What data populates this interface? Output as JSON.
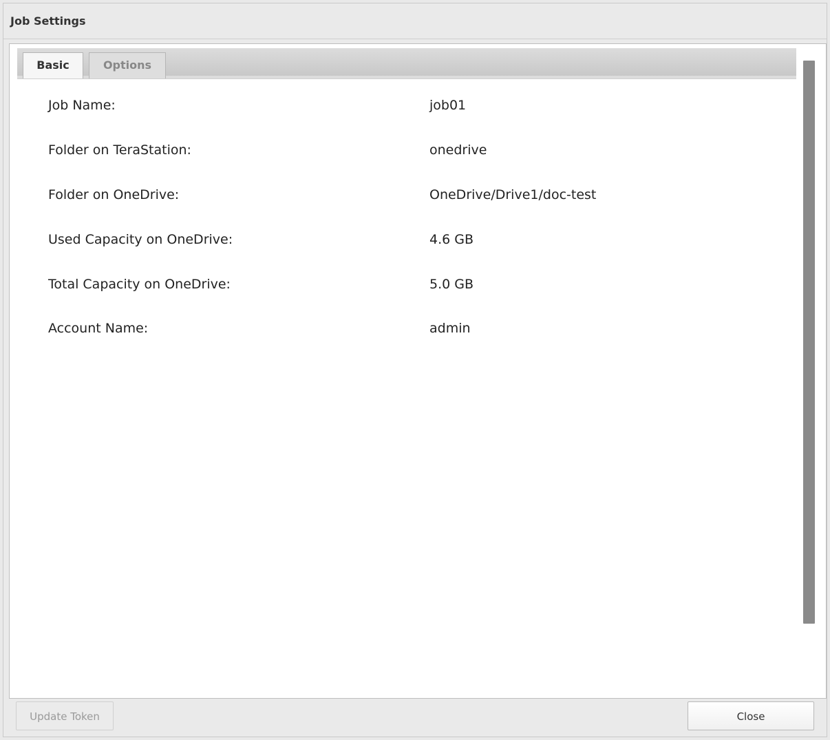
{
  "window": {
    "title": "Job Settings"
  },
  "tabs": [
    {
      "label": "Basic",
      "active": true
    },
    {
      "label": "Options",
      "active": false
    }
  ],
  "details": [
    {
      "label": "Job Name:",
      "value": "job01"
    },
    {
      "label": "Folder on TeraStation:",
      "value": "onedrive"
    },
    {
      "label": "Folder on OneDrive:",
      "value": "OneDrive/Drive1/doc-test"
    },
    {
      "label": "Used Capacity on OneDrive:",
      "value": "4.6 GB"
    },
    {
      "label": "Total Capacity on OneDrive:",
      "value": "5.0 GB"
    },
    {
      "label": "Account Name:",
      "value": "admin"
    }
  ],
  "buttons": {
    "update_token": "Update Token",
    "close": "Close"
  }
}
